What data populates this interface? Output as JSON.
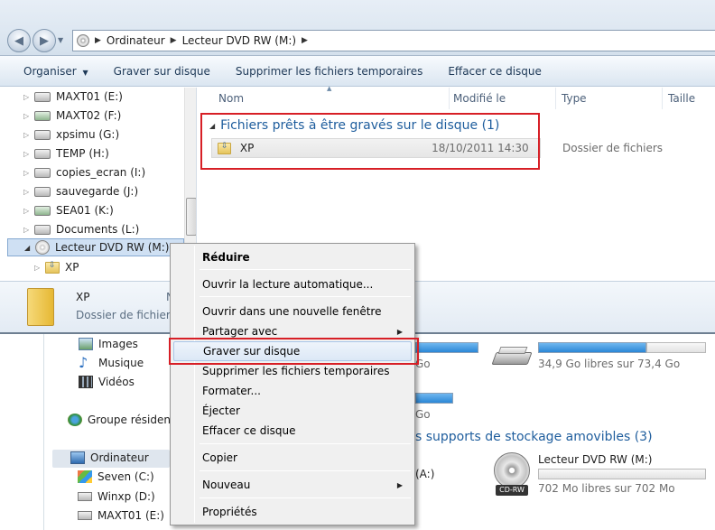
{
  "breadcrumb": [
    "Ordinateur",
    "Lecteur DVD RW (M:)"
  ],
  "toolbar": {
    "organize": "Organiser",
    "burn": "Graver sur disque",
    "delete_temp": "Supprimer les fichiers temporaires",
    "erase": "Effacer ce disque"
  },
  "nav": {
    "items": [
      {
        "label": "MAXT01 (E:)"
      },
      {
        "label": "MAXT02 (F:)"
      },
      {
        "label": "xpsimu (G:)"
      },
      {
        "label": "TEMP (H:)"
      },
      {
        "label": "copies_ecran (I:)"
      },
      {
        "label": "sauvegarde (J:)"
      },
      {
        "label": "SEA01 (K:)"
      },
      {
        "label": "Documents (L:)"
      },
      {
        "label": "Lecteur DVD RW (M:)"
      }
    ],
    "child": "XP"
  },
  "columns": {
    "name": "Nom",
    "modified": "Modifié le",
    "type": "Type",
    "size": "Taille"
  },
  "group": {
    "title": "Fichiers prêts à être gravés sur le disque (1)"
  },
  "file": {
    "name": "XP",
    "date": "18/10/2011 14:30",
    "type": "Dossier de fichiers"
  },
  "details": {
    "name": "XP",
    "type": "Dossier de fichiers",
    "trailing": "N"
  },
  "context_menu": {
    "items": [
      {
        "label": "Réduire"
      },
      {
        "label": "Ouvrir la lecture automatique..."
      },
      {
        "label": "Ouvrir dans une nouvelle fenêtre"
      },
      {
        "label": "Partager avec"
      },
      {
        "label": "Graver sur disque"
      },
      {
        "label": "Supprimer les fichiers temporaires"
      },
      {
        "label": "Formater..."
      },
      {
        "label": "Éjecter"
      },
      {
        "label": "Effacer ce disque"
      },
      {
        "label": "Copier"
      },
      {
        "label": "Nouveau"
      },
      {
        "label": "Propriétés"
      }
    ]
  },
  "background": {
    "nav": {
      "images": "Images",
      "music": "Musique",
      "videos": "Vidéos",
      "homegroup": "Groupe résidentie",
      "computer": "Ordinateur",
      "c": "Seven (C:)",
      "d": "Winxp (D:)",
      "e": "MAXT01 (E:)"
    },
    "drive1_free": "Go",
    "drive2_free": "34,9 Go libres sur 73,4 Go",
    "drive3_free": "Go",
    "removable_header": "s supports de stockage amovibles (3)",
    "removable_a": "(A:)",
    "dvd_name": "Lecteur DVD RW (M:)",
    "dvd_free": "702 Mo libres sur 702 Mo",
    "dvd_icon_label": "CD-RW"
  },
  "colors": {
    "highlight_red": "#d71f26",
    "accent_blue": "#1e5d9d"
  }
}
